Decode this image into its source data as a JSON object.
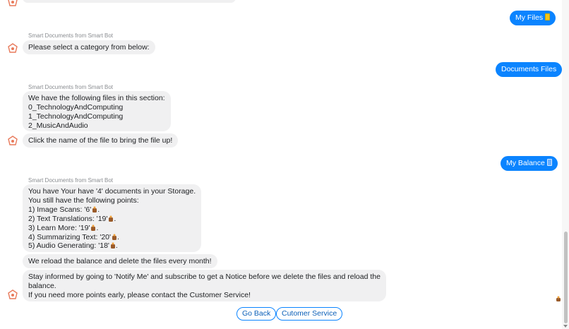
{
  "sender_name": "Smart Documents from Smart Bot",
  "outgoing": {
    "my_files": "My Files",
    "documents_files": "Documents Files",
    "my_balance": "My Balance"
  },
  "msg_category": "Please select a category from below:",
  "msg_files": {
    "lines": [
      "We have the following files in this section:",
      "0_TechnologyAndComputing",
      "1_TechnologyAndComputing",
      "2_MusicAndAudio"
    ]
  },
  "msg_click": "Click the name of the file to bring the file up!",
  "msg_storage": {
    "line1": "You have Your have '4' documents in your Storage.",
    "line2": "You still have the following points:",
    "points": [
      {
        "label": "1) Image Scans: '6'"
      },
      {
        "label": "2) Text Translations: '19'"
      },
      {
        "label": "3) Learn More: '19'"
      },
      {
        "label": "4) Summarizing Text: '20'"
      },
      {
        "label": "5) Audio Generating: '18'"
      }
    ],
    "period": "."
  },
  "msg_reload": "We reload the balance and delete the files every month!",
  "msg_notify": {
    "line1": "Stay informed by going to 'Notify Me' and subscribe to get a Notice before we delete the files and reload the",
    "line2": "balance.",
    "line3": "If you need more points early, please contact the Customer Service!"
  },
  "quick_replies": {
    "go_back": "Go Back",
    "customer_service": "Cutomer Service"
  },
  "colors": {
    "outgoing_bubble": "#0b84ff",
    "incoming_bubble": "#f0f0f1",
    "avatar_accent": "#e8795a"
  },
  "icons": [
    "bot-avatar-icon",
    "coin-icon",
    "card-icon"
  ]
}
